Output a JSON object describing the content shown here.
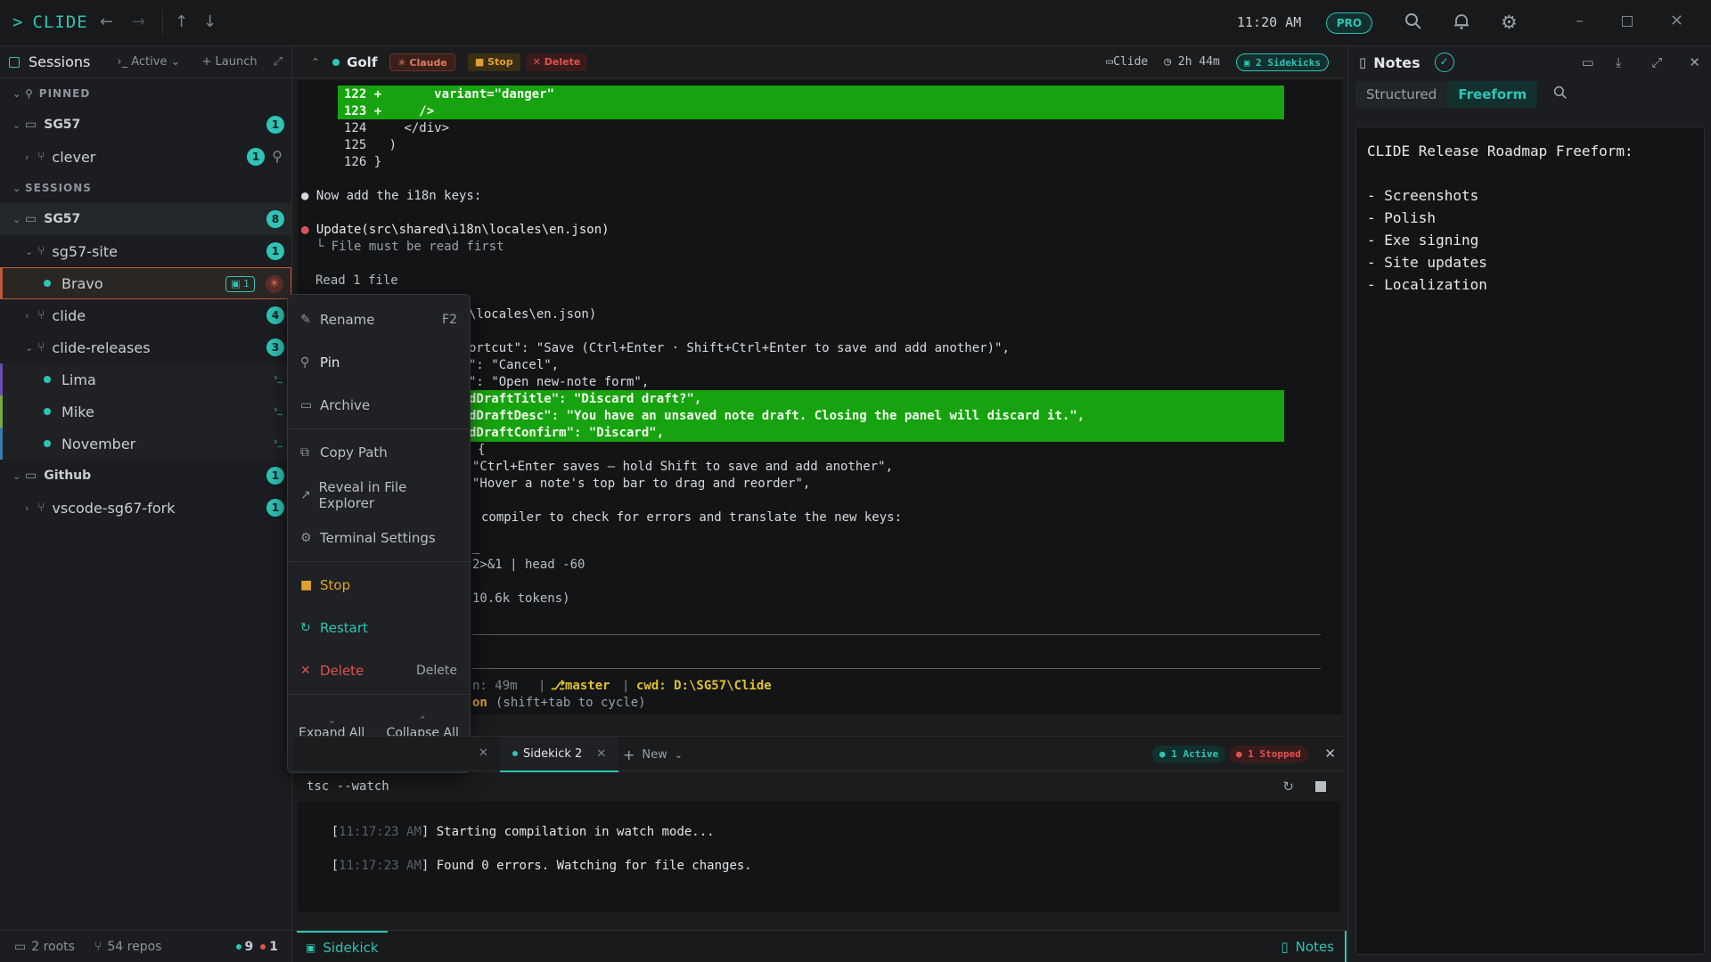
{
  "app": {
    "name": "CLIDE",
    "clock": "11:20 AM",
    "plan_badge": "PRO"
  },
  "sidebar": {
    "title": "Sessions",
    "filter": "Active",
    "launch": "Launch",
    "pinned_header": "PINNED",
    "sessions_header": "SESSIONS",
    "pinned": {
      "group": "SG57",
      "group_count": "1",
      "child": "clever",
      "child_count": "1"
    },
    "sessions": {
      "group": "SG57",
      "group_count": "8",
      "site": "sg57-site",
      "site_count": "1",
      "bravo": "Bravo",
      "bravo_badge": "1",
      "clide": "clide",
      "clide_count": "4",
      "releases": "clide-releases",
      "releases_count": "3",
      "lima": "Lima",
      "mike": "Mike",
      "november": "November",
      "github": "Github",
      "github_count": "1",
      "fork": "vscode-sg67-fork",
      "fork_count": "1"
    },
    "footer": {
      "roots": "2 roots",
      "repos": "54 repos",
      "active": "9",
      "stopped": "1"
    }
  },
  "context_menu": {
    "rename": "Rename",
    "rename_key": "F2",
    "pin": "Pin",
    "archive": "Archive",
    "copy_path": "Copy Path",
    "reveal": "Reveal in File Explorer",
    "terminal_settings": "Terminal Settings",
    "stop": "Stop",
    "restart": "Restart",
    "delete": "Delete",
    "delete_key": "Delete",
    "expand_all": "Expand All",
    "collapse_all": "Collapse All"
  },
  "main_header": {
    "session": "Golf",
    "agent": "Claude",
    "stop": "Stop",
    "delete": "Delete",
    "project": "Clide",
    "duration": "2h 44m",
    "sidekicks": "2 Sidekicks"
  },
  "terminal_lines": [
    "122 +       variant=\"danger\"",
    "123 +     />",
    "124     </div>",
    "125   )",
    "126 }",
    "● Now add the i18n keys:",
    "● Update(src\\shared\\i18n\\locales\\en.json)",
    "  └ File must be read first",
    "Read 1 file",
    "\\locales\\en.json)",
    "ortcut\": \"Save (Ctrl+Enter · Shift+Ctrl+Enter to save and add another)\",",
    "\": \"Cancel\",",
    "\": \"Open new-note form\",",
    "dDraftTitle\": \"Discard draft?\",",
    "dDraftDesc\": \"You have an unsaved note draft. Closing the panel will discard it.\",",
    "dDraftConfirm\": \"Discard\",",
    "{",
    "\"Ctrl+Enter saves — hold Shift to save and add another\",",
    "\"Hover a note's top bar to drag and reorder\",",
    "compiler to check for errors and translate the new keys:",
    "_",
    "2>&1 | head -60",
    "10.6k tokens)",
    "n: 49m",
    "master",
    "cwd: D:\\SG57\\Clide",
    "on",
    "(shift+tab to cycle)"
  ],
  "bottom_panel": {
    "tab2": "Sidekick 2",
    "new": "New",
    "active": "1 Active",
    "stopped": "1 Stopped",
    "command": "tsc --watch",
    "log": [
      {
        "time": "11:17:23 AM",
        "msg": "Starting compilation in watch mode..."
      },
      {
        "time": "11:17:23 AM",
        "msg": "Found 0 errors. Watching for file changes."
      }
    ]
  },
  "bottom_bar": {
    "sidekick": "Sidekick",
    "notes": "Notes"
  },
  "notes": {
    "title": "Notes",
    "tab_structured": "Structured",
    "tab_freeform": "Freeform",
    "heading": "CLIDE Release Roadmap Freeform:",
    "items": [
      "- Screenshots",
      "- Polish",
      "- Exe signing",
      "- Site updates",
      "- Localization"
    ]
  },
  "colors": {
    "accent": "#2ec4b6",
    "diff_green": "#17a30f",
    "danger": "#e05252",
    "warning": "#e0a030"
  }
}
